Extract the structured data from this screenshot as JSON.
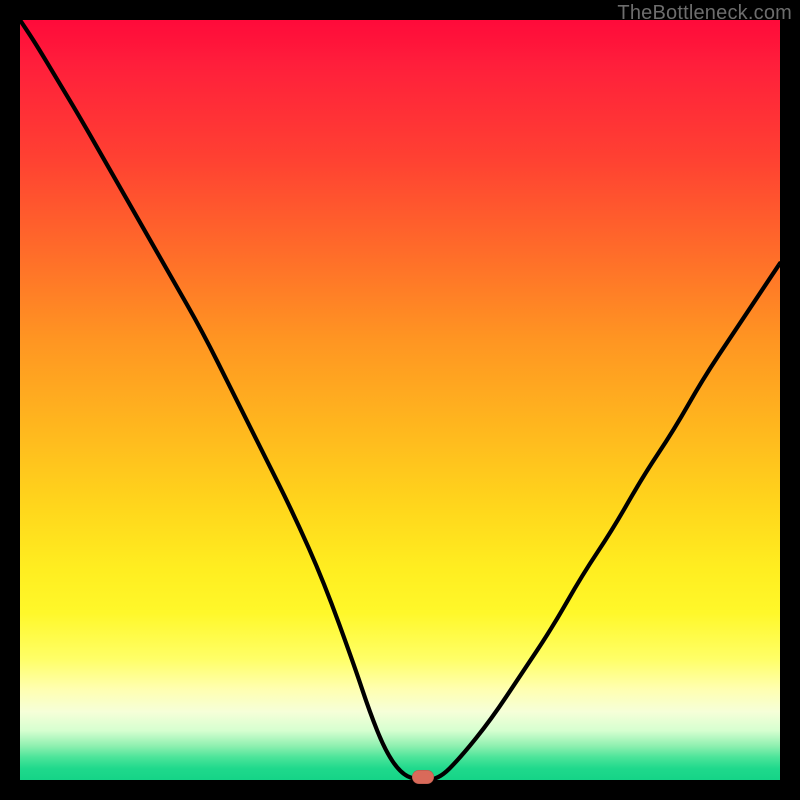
{
  "attribution": "TheBottleneck.com",
  "colors": {
    "frame_bg": "#000000",
    "curve_stroke": "#000000",
    "marker_fill": "#d96a5a",
    "attribution_text": "#6d6d6d"
  },
  "chart_data": {
    "type": "line",
    "title": "",
    "xlabel": "",
    "ylabel": "",
    "xlim": [
      0,
      100
    ],
    "ylim": [
      0,
      100
    ],
    "x": [
      0,
      2,
      5,
      8,
      12,
      16,
      20,
      24,
      28,
      32,
      36,
      40,
      44,
      46,
      48,
      50,
      52,
      55,
      58,
      62,
      66,
      70,
      74,
      78,
      82,
      86,
      90,
      94,
      98,
      100
    ],
    "series": [
      {
        "name": "bottleneck_curve",
        "values": [
          100,
          97,
          92,
          87,
          80,
          73,
          66,
          59,
          51,
          43,
          35,
          26,
          15,
          9,
          4,
          1,
          0,
          0,
          3,
          8,
          14,
          20,
          27,
          33,
          40,
          46,
          53,
          59,
          65,
          68
        ]
      }
    ],
    "marker": {
      "x": 53,
      "y": 0
    },
    "background_gradient": {
      "orientation": "vertical",
      "stops": [
        {
          "pos": 0.0,
          "color": "#ff0a3a"
        },
        {
          "pos": 0.18,
          "color": "#ff4032"
        },
        {
          "pos": 0.42,
          "color": "#ff9522"
        },
        {
          "pos": 0.64,
          "color": "#ffd61c"
        },
        {
          "pos": 0.84,
          "color": "#ffff66"
        },
        {
          "pos": 0.93,
          "color": "#d6ffd0"
        },
        {
          "pos": 1.0,
          "color": "#15d487"
        }
      ]
    }
  }
}
